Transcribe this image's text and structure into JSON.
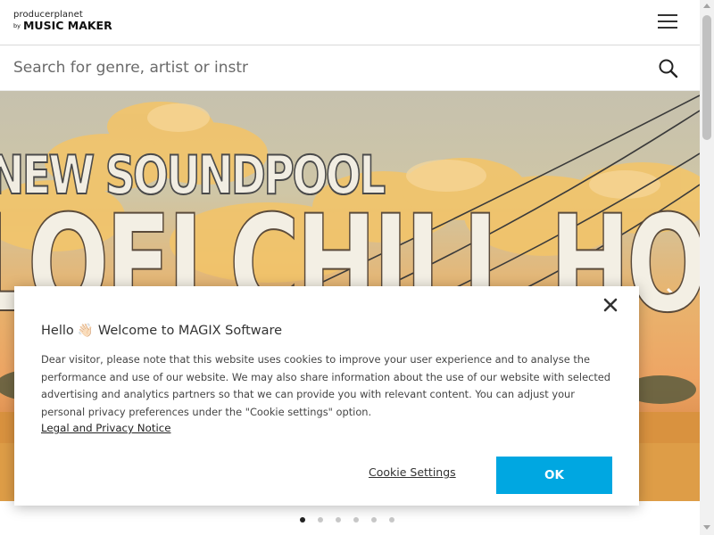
{
  "header": {
    "logo_top": "producerplanet",
    "logo_by": "by",
    "logo_bottom": "MUSIC MAKER",
    "menu_icon": "hamburger-menu-icon"
  },
  "search": {
    "placeholder": "Search for genre, artist or instr",
    "icon": "search-icon"
  },
  "hero": {
    "kicker": "NEW SOUNDPOOL",
    "title": "LOFI CHILL HOP",
    "slides_total": 6,
    "active_slide": 1
  },
  "cookie_modal": {
    "greeting": "Hello",
    "wave_emoji": "👋🏻",
    "title": "Welcome to MAGIX Software",
    "body": "Dear visitor, please note that this website uses cookies to improve your user experience and to analyse the performance and use of our website. We may also share information about the use of our website with selected advertising and analytics partners so that we can provide you with relevant content. You can adjust your personal privacy preferences under the \"Cookie settings\" option.",
    "link": "Legal and Privacy Notice",
    "settings_label": "Cookie Settings",
    "ok_label": "OK",
    "accent_color": "#00a7e1"
  }
}
